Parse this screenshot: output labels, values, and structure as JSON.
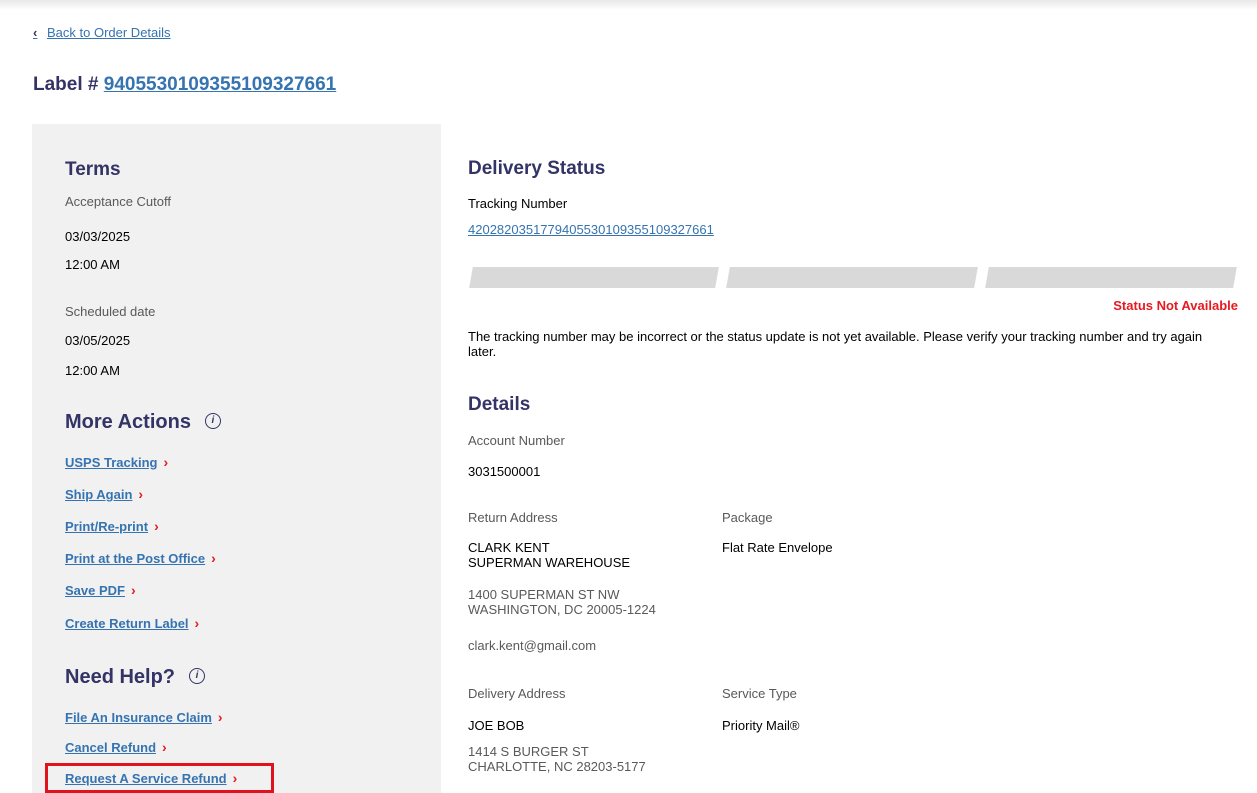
{
  "back_link": "Back to Order Details",
  "label_title_prefix": "Label #",
  "label_number": "9405530109355109327661",
  "terms": {
    "title": "Terms",
    "acceptance_label": "Acceptance Cutoff",
    "acceptance_date": "03/03/2025",
    "acceptance_time": "12:00 AM",
    "scheduled_label": "Scheduled date",
    "scheduled_date": "03/05/2025",
    "scheduled_time": "12:00 AM"
  },
  "more_actions": {
    "title": "More Actions",
    "icon": "info-icon",
    "links": [
      "USPS Tracking",
      "Ship Again",
      "Print/Re-print",
      "Print at the Post Office",
      "Save PDF",
      "Create Return Label"
    ]
  },
  "need_help": {
    "title": "Need Help?",
    "icon": "info-icon",
    "links": [
      "File An Insurance Claim",
      "Cancel Refund",
      "Request A Service Refund"
    ]
  },
  "delivery_status": {
    "title": "Delivery Status",
    "tracking_label": "Tracking Number",
    "tracking_number": "420282035177940553010935510932766 1",
    "status_text": "Status Not Available",
    "message": "The tracking number may be incorrect or the status update is not yet available. Please verify your tracking number and try again later."
  },
  "details": {
    "title": "Details",
    "account_label": "Account Number",
    "account_number": "3031500001",
    "return_label": "Return Address",
    "return_name": "CLARK KENT",
    "return_company": "SUPERMAN WAREHOUSE",
    "return_street": "1400 SUPERMAN ST NW",
    "return_city": "WASHINGTON, DC 20005-1224",
    "return_email": "clark.kent@gmail.com",
    "package_label": "Package",
    "package_value": "Flat Rate Envelope",
    "delivery_label": "Delivery Address",
    "delivery_name": "JOE BOB",
    "delivery_street": "1414 S BURGER ST",
    "delivery_city": "CHARLOTTE, NC 28203-5177",
    "service_label": "Service Type",
    "service_value": "Priority Mail®"
  },
  "colors": {
    "heading": "#333366",
    "link": "#3573b1",
    "accent_red": "#e71921",
    "sidebar_bg": "#f1f1f1",
    "bar_gray": "#d9d9d9"
  }
}
